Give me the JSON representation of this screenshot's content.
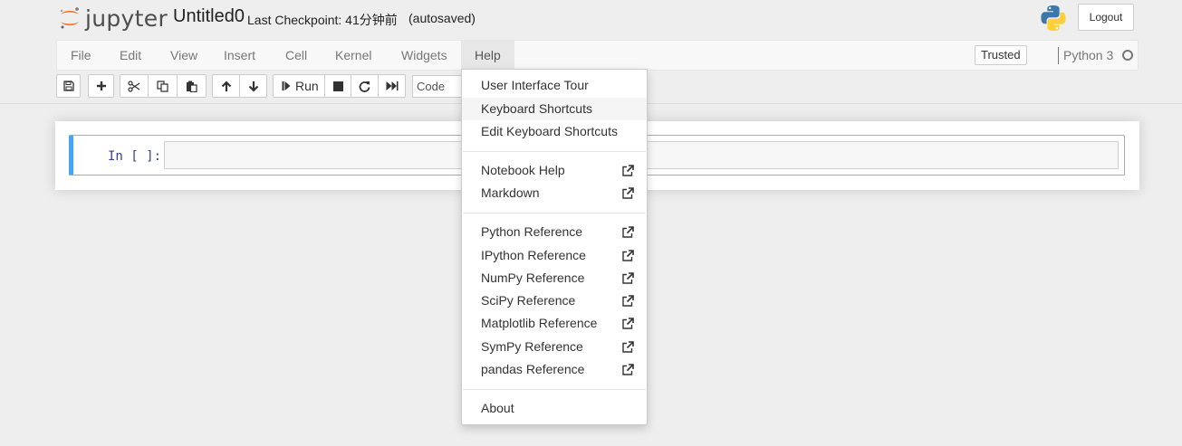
{
  "header": {
    "logo_text": "jupyter",
    "notebook_name": "Untitled0",
    "checkpoint": "Last Checkpoint: 41分钟前",
    "autosave_status": "(autosaved)",
    "logout_label": "Logout"
  },
  "menubar": {
    "items": [
      "File",
      "Edit",
      "View",
      "Insert",
      "Cell",
      "Kernel",
      "Widgets",
      "Help"
    ],
    "trusted_label": "Trusted",
    "kernel_name": "Python 3"
  },
  "toolbar": {
    "run_label": "Run",
    "cell_type": "Code"
  },
  "cell": {
    "prompt": "In [ ]:",
    "source": ""
  },
  "help_menu": {
    "items": [
      {
        "label": "User Interface Tour"
      },
      {
        "label": "Keyboard Shortcuts"
      },
      {
        "label": "Edit Keyboard Shortcuts"
      },
      {
        "label": "Notebook Help"
      },
      {
        "label": "Markdown"
      },
      {
        "label": "Python Reference"
      },
      {
        "label": "IPython Reference"
      },
      {
        "label": "NumPy Reference"
      },
      {
        "label": "SciPy Reference"
      },
      {
        "label": "Matplotlib Reference"
      },
      {
        "label": "SymPy Reference"
      },
      {
        "label": "pandas Reference"
      },
      {
        "label": "About"
      }
    ]
  },
  "colors": {
    "accent": "#42a5f5",
    "jupyter_orange": "#f37726",
    "prompt_blue": "#303f9f"
  },
  "icons": {
    "save": "floppy-disk-icon",
    "insert": "plus-icon",
    "cut": "scissors-icon",
    "copy": "copy-icon",
    "paste": "paste-icon",
    "move_up": "arrow-up-icon",
    "move_down": "arrow-down-icon",
    "run": "step-forward-icon",
    "stop": "stop-icon",
    "restart": "refresh-icon",
    "restart_run_all": "fast-forward-icon",
    "external": "external-link-icon"
  }
}
